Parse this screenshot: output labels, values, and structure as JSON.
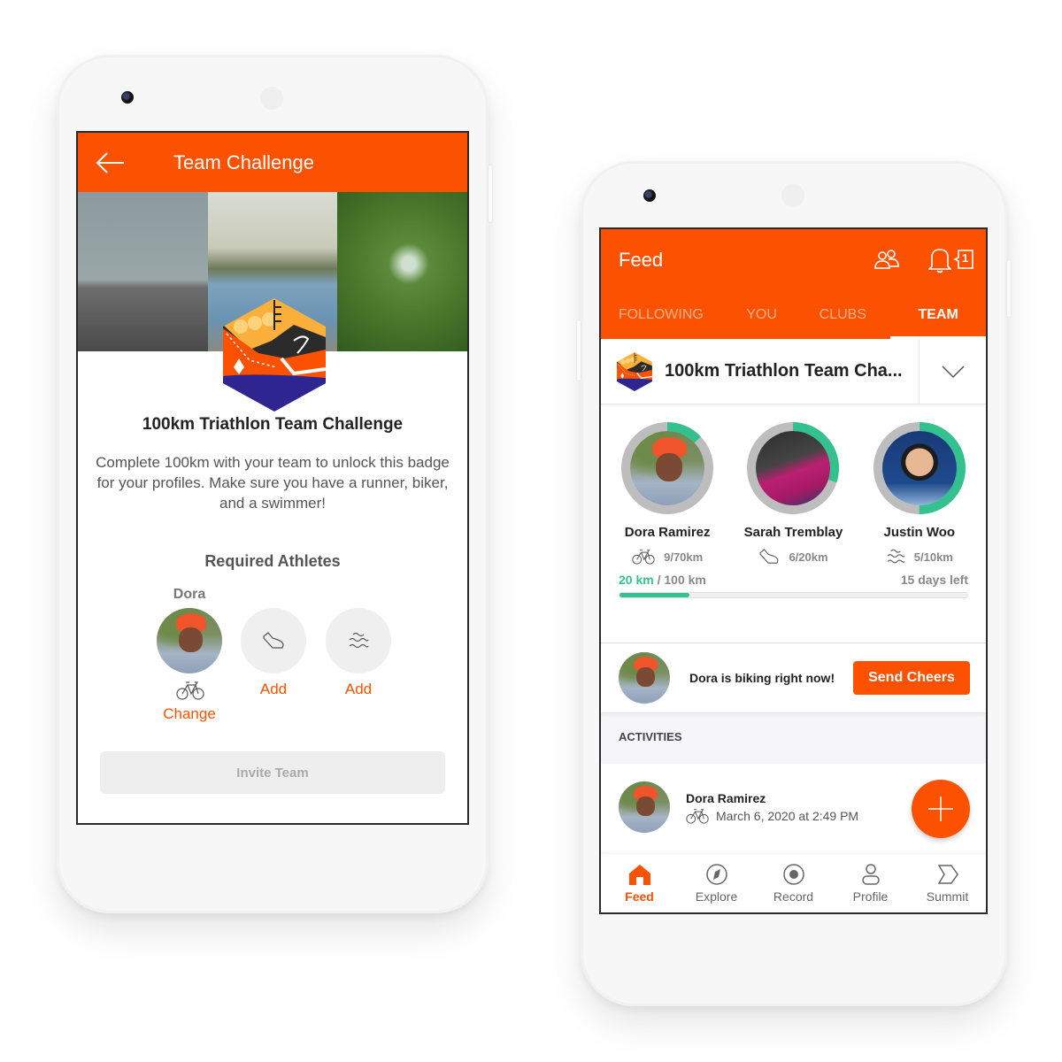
{
  "colors": {
    "brand": "#fc5200",
    "progress": "#33c28f",
    "ring_track": "#bdbdbd"
  },
  "left_screen": {
    "appbar": {
      "title": "Team Challenge",
      "back_icon": "arrow-left-icon"
    },
    "hero_photos": [
      "cyclist-photo",
      "runner-photo",
      "swimmer-photo"
    ],
    "challenge": {
      "title": "100km Triathlon Team Challenge",
      "description": "Complete 100km with your team to unlock this badge for your profiles. Make sure you have a runner, biker, and a swimmer!"
    },
    "required_athletes": {
      "heading": "Required Athletes",
      "slots": [
        {
          "name": "Dora",
          "sport_icon": "bike-icon",
          "action": "Change",
          "filled": true
        },
        {
          "name": "",
          "sport_icon": "shoe-icon",
          "action": "Add",
          "filled": false
        },
        {
          "name": "",
          "sport_icon": "waves-icon",
          "action": "Add",
          "filled": false
        }
      ]
    },
    "invite_button": "Invite Team"
  },
  "right_screen": {
    "appbar": {
      "title": "Feed",
      "notification_count": "1",
      "icons": [
        "people-icon",
        "bell-icon"
      ]
    },
    "tabs": [
      {
        "label": "FOLLOWING",
        "active": false
      },
      {
        "label": "YOU",
        "active": false
      },
      {
        "label": "CLUBS",
        "active": false
      },
      {
        "label": "TEAM",
        "active": true
      }
    ],
    "challenge_selector": {
      "title": "100km Triathlon Team Cha..."
    },
    "members": [
      {
        "name": "Dora Ramirez",
        "sport_icon": "bike-icon",
        "stat": "9/70km",
        "progress": 0.13
      },
      {
        "name": "Sarah Tremblay",
        "sport_icon": "shoe-icon",
        "stat": "6/20km",
        "progress": 0.3
      },
      {
        "name": "Justin Woo",
        "sport_icon": "waves-icon",
        "stat": "5/10km",
        "progress": 0.5
      }
    ],
    "team_progress": {
      "done": "20 km",
      "total": " / 100 km",
      "remaining": "15 days left",
      "fraction": 0.2
    },
    "live": {
      "message": "Dora is biking right now!",
      "button": "Send Cheers"
    },
    "activities": {
      "header": "ACTIVITIES",
      "items": [
        {
          "name": "Dora Ramirez",
          "sport_icon": "bike-icon",
          "datetime": "March 6, 2020 at 2:49 PM"
        }
      ]
    },
    "bottom_nav": [
      {
        "label": "Feed",
        "icon": "home-icon",
        "active": true
      },
      {
        "label": "Explore",
        "icon": "compass-icon",
        "active": false
      },
      {
        "label": "Record",
        "icon": "record-icon",
        "active": false
      },
      {
        "label": "Profile",
        "icon": "person-icon",
        "active": false
      },
      {
        "label": "Summit",
        "icon": "summit-icon",
        "active": false
      }
    ]
  }
}
